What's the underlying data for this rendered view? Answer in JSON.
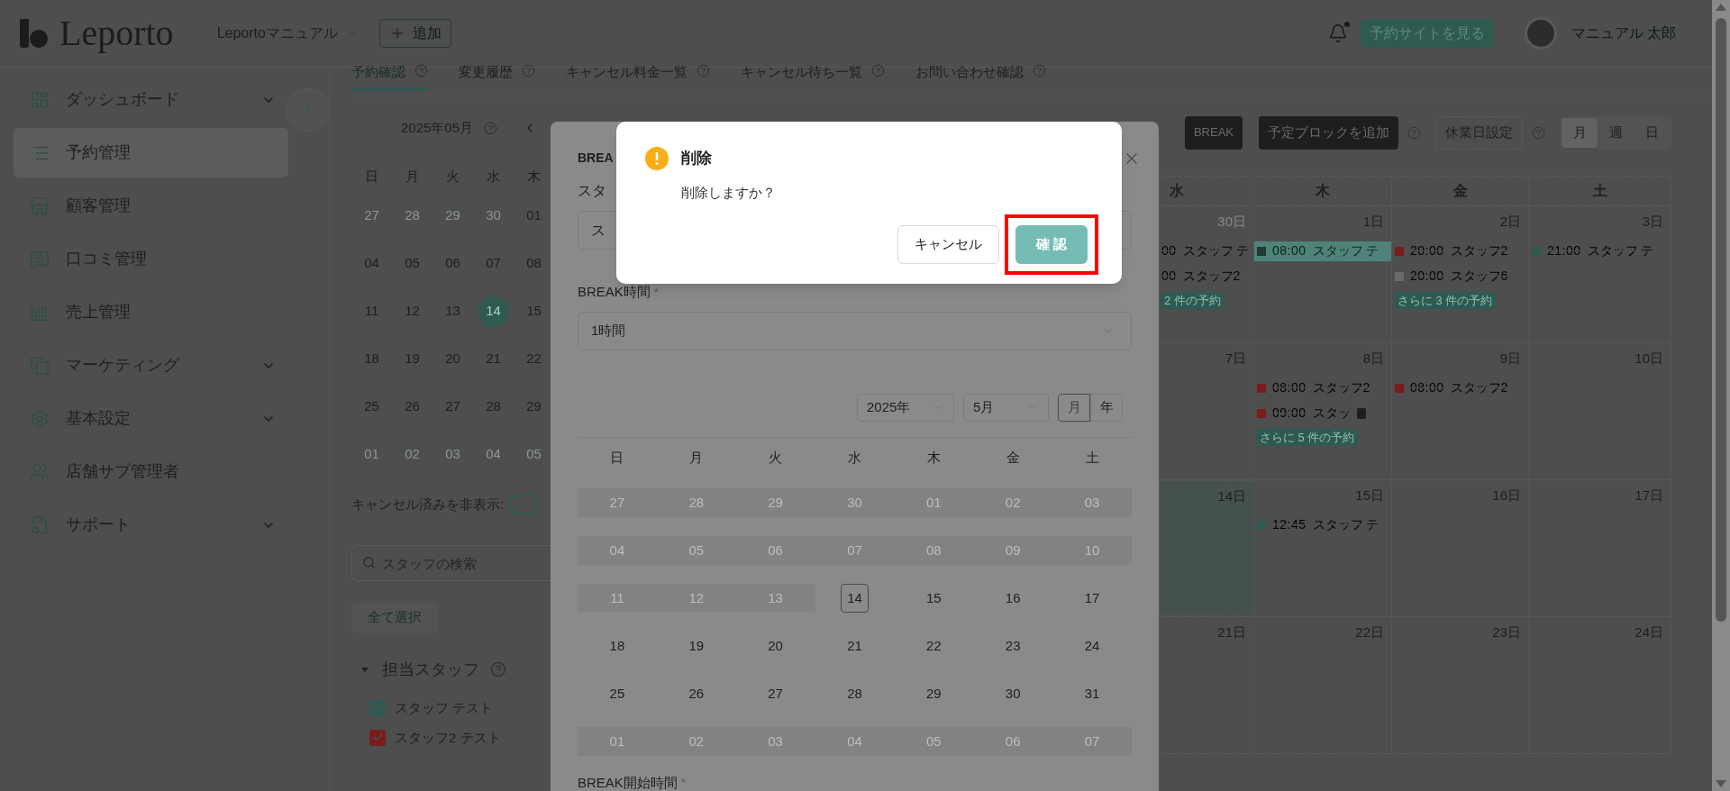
{
  "header": {
    "logo": "Leporto",
    "store": "Leportoマニュアル",
    "add_button": "追加",
    "has_unread": true,
    "site_button": "予約サイトを見る",
    "user": "マニュアル 太郎"
  },
  "sidebar": {
    "items": [
      {
        "label": "ダッシュボード",
        "expandable": true,
        "selected": false
      },
      {
        "label": "予約管理",
        "expandable": false,
        "selected": true
      },
      {
        "label": "顧客管理",
        "expandable": false,
        "selected": false
      },
      {
        "label": "口コミ管理",
        "expandable": false,
        "selected": false
      },
      {
        "label": "売上管理",
        "expandable": false,
        "selected": false
      },
      {
        "label": "マーケティング",
        "expandable": true,
        "selected": false
      },
      {
        "label": "基本設定",
        "expandable": true,
        "selected": false
      },
      {
        "label": "店舗サブ管理者",
        "expandable": false,
        "selected": false
      },
      {
        "label": "サポート",
        "expandable": true,
        "selected": false
      }
    ]
  },
  "tabs": [
    {
      "label": "予約確認",
      "selected": true
    },
    {
      "label": "変更履歴",
      "selected": false
    },
    {
      "label": "キャンセル料金一覧",
      "selected": false
    },
    {
      "label": "キャンセル待ち一覧",
      "selected": false
    },
    {
      "label": "お問い合わせ確認",
      "selected": false
    }
  ],
  "mini_calendar": {
    "title": "2025年05月",
    "weekdays": [
      "日",
      "月",
      "火",
      "水",
      "木"
    ],
    "weeks": [
      [
        {
          "label": "27",
          "outside": true,
          "selected": false
        },
        {
          "label": "28",
          "outside": true,
          "selected": false
        },
        {
          "label": "29",
          "outside": true,
          "selected": false
        },
        {
          "label": "30",
          "outside": true,
          "selected": false
        },
        {
          "label": "01",
          "outside": false,
          "selected": false
        }
      ],
      [
        {
          "label": "04",
          "outside": false,
          "selected": false
        },
        {
          "label": "05",
          "outside": false,
          "selected": false
        },
        {
          "label": "06",
          "outside": false,
          "selected": false
        },
        {
          "label": "07",
          "outside": false,
          "selected": false
        },
        {
          "label": "08",
          "outside": false,
          "selected": false
        }
      ],
      [
        {
          "label": "11",
          "outside": false,
          "selected": false
        },
        {
          "label": "12",
          "outside": false,
          "selected": false
        },
        {
          "label": "13",
          "outside": false,
          "selected": false
        },
        {
          "label": "14",
          "outside": false,
          "selected": true
        },
        {
          "label": "15",
          "outside": false,
          "selected": false
        }
      ],
      [
        {
          "label": "18",
          "outside": false,
          "selected": false
        },
        {
          "label": "19",
          "outside": false,
          "selected": false
        },
        {
          "label": "20",
          "outside": false,
          "selected": false
        },
        {
          "label": "21",
          "outside": false,
          "selected": false
        },
        {
          "label": "22",
          "outside": false,
          "selected": false
        }
      ],
      [
        {
          "label": "25",
          "outside": false,
          "selected": false
        },
        {
          "label": "26",
          "outside": false,
          "selected": false
        },
        {
          "label": "27",
          "outside": false,
          "selected": false
        },
        {
          "label": "28",
          "outside": false,
          "selected": false
        },
        {
          "label": "29",
          "outside": false,
          "selected": false
        }
      ],
      [
        {
          "label": "01",
          "outside": true,
          "selected": false
        },
        {
          "label": "02",
          "outside": true,
          "selected": false
        },
        {
          "label": "03",
          "outside": true,
          "selected": false
        },
        {
          "label": "04",
          "outside": true,
          "selected": false
        },
        {
          "label": "05",
          "outside": true,
          "selected": false
        }
      ]
    ]
  },
  "filters": {
    "hide_cancelled_label": "キャンセル済みを非表示:",
    "hide_cancelled_on": false,
    "search_placeholder": "スタッフの検索",
    "select_all": "全て選択",
    "staff_heading": "担当スタッフ",
    "staff_expanded": true,
    "staff": [
      {
        "name": "スタッフ テスト",
        "checked": true,
        "color": "#2f5a52"
      },
      {
        "name": "スタッフ2 テスト",
        "checked": true,
        "color": "#7a1c1c"
      }
    ]
  },
  "toolbar": {
    "break_button": "BREAK",
    "add_block_button": "予定ブロックを追加",
    "holiday_button": "休業日設定",
    "views": [
      {
        "label": "月",
        "selected": true
      },
      {
        "label": "週",
        "selected": false
      },
      {
        "label": "日",
        "selected": false
      }
    ]
  },
  "calendar": {
    "weekdays": [
      "水",
      "木",
      "金",
      "土"
    ],
    "weeks": [
      [
        {
          "date": "30日",
          "outside": true,
          "selected": false,
          "events": [
            {
              "time": "00",
              "staff": "スタッフ テ",
              "cancelled": true,
              "highlighted": false,
              "note": false
            },
            {
              "time": "00",
              "staff": "スタッフ2",
              "cancelled": true,
              "highlighted": false,
              "note": false
            }
          ],
          "more": "2 件の予約"
        },
        {
          "date": "1日",
          "outside": false,
          "selected": false,
          "events": [
            {
              "time": "08:00",
              "staff": "スタッフ テ",
              "color": "#1f3a34",
              "cancelled": false,
              "highlighted": true,
              "note": false
            }
          ]
        },
        {
          "date": "2日",
          "outside": false,
          "selected": false,
          "events": [
            {
              "time": "20:00",
              "staff": "スタッフ2",
              "color": "#7a1c1c",
              "cancelled": true,
              "highlighted": false,
              "note": false
            },
            {
              "time": "20:00",
              "staff": "スタッフ6",
              "color": "#6a6a6a",
              "cancelled": true,
              "highlighted": false,
              "note": false
            }
          ],
          "more": "さらに 3 件の予約"
        },
        {
          "date": "3日",
          "outside": false,
          "selected": false,
          "events": [
            {
              "time": "21:00",
              "staff": "スタッフ テ",
              "color": "#2f5a52",
              "cancelled": true,
              "highlighted": false,
              "note": false
            }
          ]
        }
      ],
      [
        {
          "date": "7日",
          "outside": false,
          "selected": false
        },
        {
          "date": "8日",
          "outside": false,
          "selected": false,
          "events": [
            {
              "time": "08:00",
              "staff": "スタッフ2",
              "color": "#7a1c1c",
              "cancelled": true,
              "highlighted": false,
              "note": false
            },
            {
              "time": "09:00",
              "staff": "スタッ",
              "color": "#7a1c1c",
              "cancelled": true,
              "highlighted": false,
              "note": true
            }
          ],
          "more": "さらに 5 件の予約"
        },
        {
          "date": "9日",
          "outside": false,
          "selected": false,
          "events": [
            {
              "time": "08:00",
              "staff": "スタッフ2",
              "color": "#7a1c1c",
              "cancelled": true,
              "highlighted": false,
              "note": false
            }
          ]
        },
        {
          "date": "10日",
          "outside": false,
          "selected": false
        }
      ],
      [
        {
          "date": "14日",
          "outside": false,
          "selected": true
        },
        {
          "date": "15日",
          "outside": false,
          "selected": false,
          "events": [
            {
              "time": "12:45",
              "staff": "スタッフ テ",
              "color": "#2f5a52",
              "cancelled": true,
              "highlighted": false,
              "note": false
            }
          ]
        },
        {
          "date": "16日",
          "outside": false,
          "selected": false
        },
        {
          "date": "17日",
          "outside": false,
          "selected": false
        }
      ],
      [
        {
          "date": "21日",
          "outside": false,
          "selected": false
        },
        {
          "date": "22日",
          "outside": false,
          "selected": false
        },
        {
          "date": "23日",
          "outside": false,
          "selected": false
        },
        {
          "date": "24日",
          "outside": false,
          "selected": false
        }
      ]
    ]
  },
  "break_form": {
    "title": "BREA",
    "staff_label": "スタ",
    "staff_value": "ス",
    "duration_label": "BREAK時間",
    "required_mark": "*",
    "duration_value": "1時間",
    "year_select": "2025年",
    "month_select": "5月",
    "modes": [
      {
        "label": "月",
        "selected": true
      },
      {
        "label": "年",
        "selected": false
      }
    ],
    "weekdays": [
      "日",
      "月",
      "火",
      "水",
      "木",
      "金",
      "土"
    ],
    "weeks": [
      [
        {
          "label": "27",
          "disabled": true,
          "selected": false
        },
        {
          "label": "28",
          "disabled": true,
          "selected": false
        },
        {
          "label": "29",
          "disabled": true,
          "selected": false
        },
        {
          "label": "30",
          "disabled": true,
          "selected": false
        },
        {
          "label": "01",
          "disabled": true,
          "selected": false
        },
        {
          "label": "02",
          "disabled": true,
          "selected": false
        },
        {
          "label": "03",
          "disabled": true,
          "selected": false
        }
      ],
      [
        {
          "label": "04",
          "disabled": true,
          "selected": false
        },
        {
          "label": "05",
          "disabled": true,
          "selected": false
        },
        {
          "label": "06",
          "disabled": true,
          "selected": false
        },
        {
          "label": "07",
          "disabled": true,
          "selected": false
        },
        {
          "label": "08",
          "disabled": true,
          "selected": false
        },
        {
          "label": "09",
          "disabled": true,
          "selected": false
        },
        {
          "label": "10",
          "disabled": true,
          "selected": false
        }
      ],
      [
        {
          "label": "11",
          "disabled": true,
          "selected": false
        },
        {
          "label": "12",
          "disabled": true,
          "selected": false
        },
        {
          "label": "13",
          "disabled": true,
          "selected": false
        },
        {
          "label": "14",
          "disabled": false,
          "selected": true
        },
        {
          "label": "15",
          "disabled": false,
          "selected": false
        },
        {
          "label": "16",
          "disabled": false,
          "selected": false
        },
        {
          "label": "17",
          "disabled": false,
          "selected": false
        }
      ],
      [
        {
          "label": "18",
          "disabled": false,
          "selected": false
        },
        {
          "label": "19",
          "disabled": false,
          "selected": false
        },
        {
          "label": "20",
          "disabled": false,
          "selected": false
        },
        {
          "label": "21",
          "disabled": false,
          "selected": false
        },
        {
          "label": "22",
          "disabled": false,
          "selected": false
        },
        {
          "label": "23",
          "disabled": false,
          "selected": false
        },
        {
          "label": "24",
          "disabled": false,
          "selected": false
        }
      ],
      [
        {
          "label": "25",
          "disabled": false,
          "selected": false
        },
        {
          "label": "26",
          "disabled": false,
          "selected": false
        },
        {
          "label": "27",
          "disabled": false,
          "selected": false
        },
        {
          "label": "28",
          "disabled": false,
          "selected": false
        },
        {
          "label": "29",
          "disabled": false,
          "selected": false
        },
        {
          "label": "30",
          "disabled": false,
          "selected": false
        },
        {
          "label": "31",
          "disabled": false,
          "selected": false
        }
      ],
      [
        {
          "label": "01",
          "disabled": true,
          "selected": false
        },
        {
          "label": "02",
          "disabled": true,
          "selected": false
        },
        {
          "label": "03",
          "disabled": true,
          "selected": false
        },
        {
          "label": "04",
          "disabled": true,
          "selected": false
        },
        {
          "label": "05",
          "disabled": true,
          "selected": false
        },
        {
          "label": "06",
          "disabled": true,
          "selected": false
        },
        {
          "label": "07",
          "disabled": true,
          "selected": false
        }
      ]
    ],
    "start_label": "BREAK開始時間"
  },
  "confirm_dialog": {
    "title": "削除",
    "message": "削除しますか？",
    "cancel_button": "キャンセル",
    "confirm_button": "確 認",
    "confirm_highlighted": true
  }
}
